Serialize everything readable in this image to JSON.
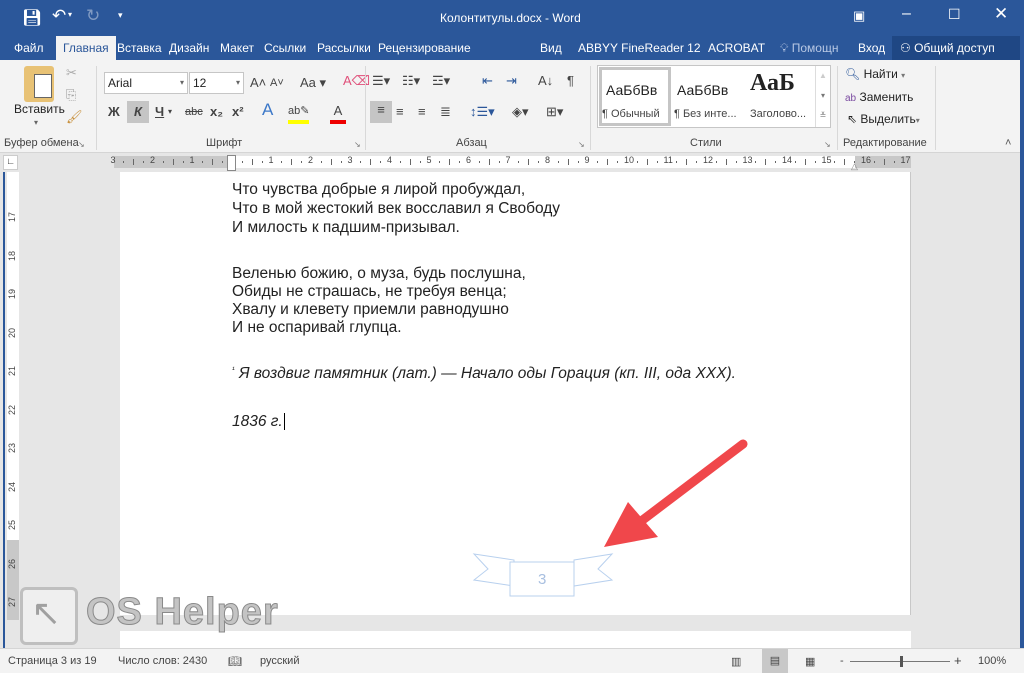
{
  "window": {
    "title": "Колонтитулы.docx - Word"
  },
  "tabs": [
    "Файл",
    "Главная",
    "Вставка",
    "Дизайн",
    "Макет",
    "Ссылки",
    "Рассылки",
    "Рецензирование",
    "Вид",
    "ABBYY FineReader 12",
    "ACROBAT"
  ],
  "tell_me": "Помощн",
  "sign_in": "Вход",
  "share": "Общий доступ",
  "ribbon": {
    "clipboard": {
      "paste": "Вставить",
      "label": "Буфер обмена"
    },
    "font": {
      "name": "Arial",
      "size": "12",
      "label": "Шрифт",
      "change_case": "Aa",
      "bold": "Ж",
      "italic": "К",
      "underline": "Ч",
      "strike": "abc",
      "sub": "x₂",
      "sup": "x²"
    },
    "paragraph": {
      "label": "Абзац"
    },
    "styles": {
      "label": "Стили",
      "items": [
        {
          "preview": "АаБбВв",
          "name": "¶ Обычный"
        },
        {
          "preview": "АаБбВв",
          "name": "¶ Без инте..."
        },
        {
          "preview": "АаБ",
          "name": "Заголово..."
        }
      ]
    },
    "editing": {
      "label": "Редактирование",
      "find": "Найти",
      "replace": "Заменить",
      "select": "Выделить"
    }
  },
  "document": {
    "lines": [
      "Что чувства добрые я лирой пробуждал,",
      "Что в мой жестокий век восславил я Свободу",
      "И милость к падшим-призывал.",
      "Веленью божию, о муза, будь послушна,",
      "Обиды не страшась, не требуя венца;",
      "Хвалу и клевету приемли равнодушно",
      "И не оспаривай глупца."
    ],
    "footnote_mark": "¹",
    "footnote": "Я воздвиг памятник (лат.) — Начало оды Горация (кп. III, ода XXX).",
    "date": "1836 г.",
    "page_number": "3"
  },
  "watermark": "OS Helper",
  "status": {
    "page": "Страница 3 из 19",
    "words": "Число слов: 2430",
    "language": "русский",
    "zoom": "100%",
    "zoom_percent": 100
  },
  "colors": {
    "accent": "#2b579a",
    "arrow": "#f0474b"
  }
}
